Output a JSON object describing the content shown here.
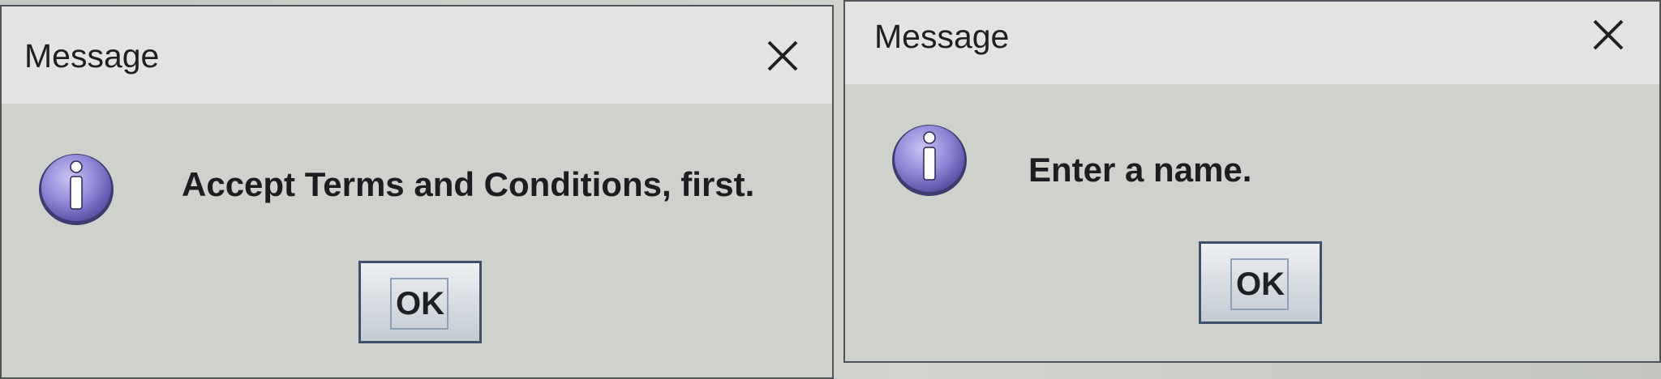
{
  "dialogs": [
    {
      "title": "Message",
      "message": "Accept Terms and Conditions, first.",
      "ok_label": "OK",
      "icon": "info-icon",
      "close_icon": "close-icon"
    },
    {
      "title": "Message",
      "message": "Enter a name.",
      "ok_label": "OK",
      "icon": "info-icon",
      "close_icon": "close-icon"
    }
  ],
  "colors": {
    "dialog_body": "#cfd1cc",
    "title_bar": "#e3e4e1",
    "info_icon_fill": "#8f86d6",
    "ok_button_border": "#3d4f6a",
    "text": "#1c1d21"
  }
}
